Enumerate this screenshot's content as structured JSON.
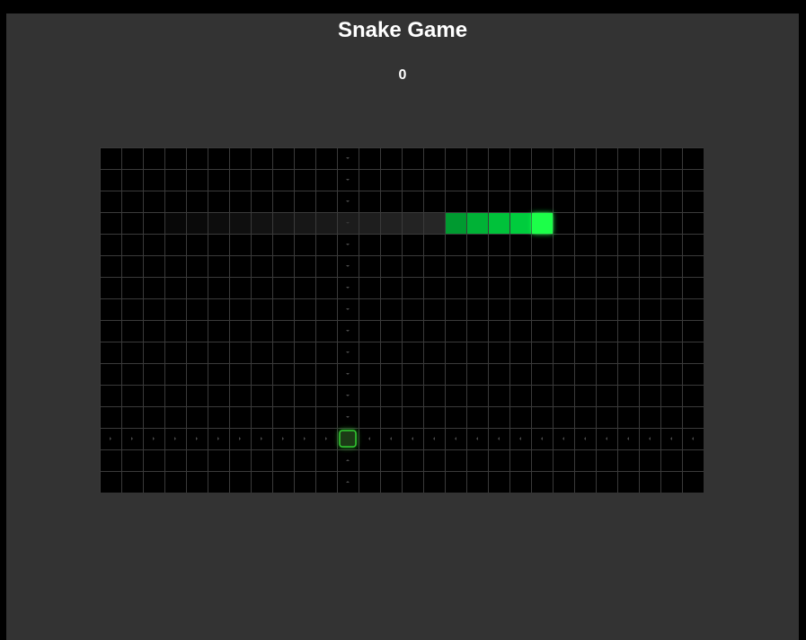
{
  "game": {
    "title": "Snake Game",
    "score": "0"
  },
  "grid": {
    "cols": 28,
    "rows": 16
  },
  "snake": {
    "head": [
      20,
      3
    ],
    "body": [
      [
        19,
        3
      ],
      [
        18,
        3
      ],
      [
        17,
        3
      ],
      [
        16,
        3
      ]
    ],
    "trail": [
      [
        15,
        3
      ],
      [
        14,
        3
      ],
      [
        13,
        3
      ],
      [
        12,
        3
      ],
      [
        11,
        3
      ],
      [
        10,
        3
      ],
      [
        9,
        3
      ],
      [
        8,
        3
      ],
      [
        7,
        3
      ],
      [
        6,
        3
      ],
      [
        5,
        3
      ],
      [
        4,
        3
      ],
      [
        3,
        3
      ]
    ]
  },
  "food": {
    "cell": [
      11,
      13
    ]
  },
  "direction_hints": {
    "column": 11,
    "row": 13
  },
  "colors": {
    "page_bg": "#000000",
    "panel_bg": "#333333",
    "board_bg": "#000000",
    "grid_line": "#3a3a3a",
    "snake_head": "#1aff4a",
    "snake_body": [
      "#00cc3d",
      "#00c23a",
      "#00b236",
      "#009a30"
    ],
    "trail": "#2a2a2a",
    "food_stroke": "#33cc33",
    "food_fill": "#1b3a16",
    "hint": "#4a4a4a"
  }
}
